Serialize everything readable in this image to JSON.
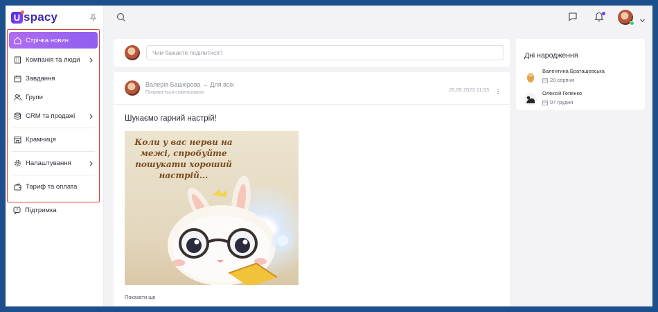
{
  "app": {
    "logo_text": "spacy",
    "logo_letter": "U"
  },
  "sidebar": {
    "items": [
      {
        "label": "Стрічка новин",
        "icon": "home-icon",
        "active": true,
        "chevron": false
      },
      {
        "label": "Компанія та люди",
        "icon": "building-icon",
        "active": false,
        "chevron": true
      },
      {
        "label": "Завдання",
        "icon": "calendar-icon",
        "active": false,
        "chevron": false
      },
      {
        "label": "Групи",
        "icon": "group-icon",
        "active": false,
        "chevron": false
      },
      {
        "label": "CRM та продажі",
        "icon": "database-icon",
        "active": false,
        "chevron": true
      },
      {
        "label": "Крамниця",
        "icon": "store-icon",
        "active": false,
        "chevron": false
      },
      {
        "label": "Налаштування",
        "icon": "gear-icon",
        "active": false,
        "chevron": true
      },
      {
        "label": "Тариф та оплата",
        "icon": "wallet-icon",
        "active": false,
        "chevron": false
      }
    ],
    "support_label": "Підтримка"
  },
  "composer": {
    "placeholder": "Чим бажаєте поділитися?"
  },
  "post": {
    "author": "Валерія Башкірова → Для всіх",
    "status": "Почувається схвильовано",
    "date": "25.05.2023 11:53",
    "title": "Шукаємо гарний настрій!",
    "image_text": "Коли у вас нерви на межі, спробуйте пошукати хороший настрій...",
    "show_more": "Показати ще"
  },
  "birthdays": {
    "title": "Дні народження",
    "people": [
      {
        "name": "Валентина Браташевська",
        "date": "20 серпня"
      },
      {
        "name": "Олексій Гепенко",
        "date": "07 грудня"
      }
    ]
  },
  "colors": {
    "accent": "#8f5ef0",
    "highlight_border": "#d9453c",
    "online": "#3bc86b"
  }
}
